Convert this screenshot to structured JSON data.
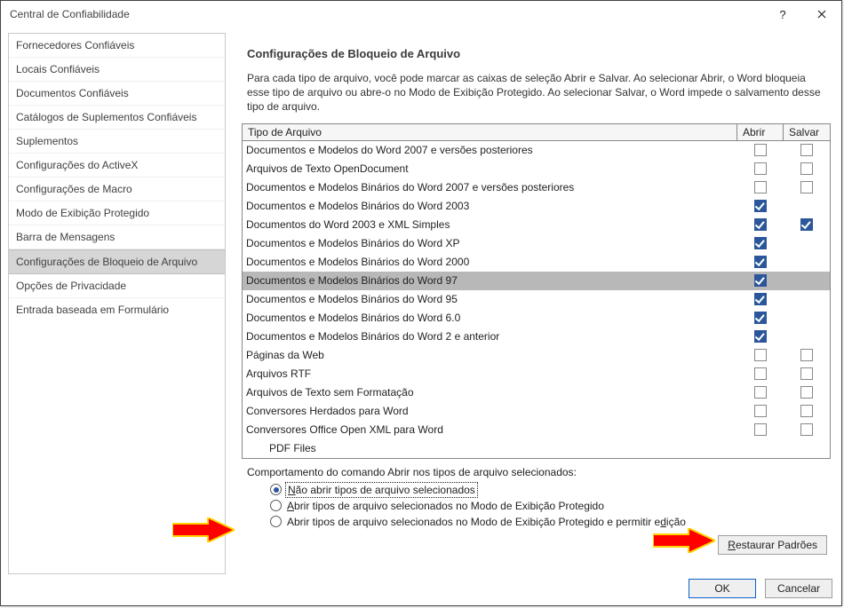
{
  "window": {
    "title": "Central de Confiabilidade"
  },
  "sidebar": {
    "items": [
      {
        "label": "Fornecedores Confiáveis"
      },
      {
        "label": "Locais Confiáveis"
      },
      {
        "label": "Documentos Confiáveis"
      },
      {
        "label": "Catálogos de Suplementos Confiáveis"
      },
      {
        "label": "Suplementos"
      },
      {
        "label": "Configurações do ActiveX"
      },
      {
        "label": "Configurações de Macro"
      },
      {
        "label": "Modo de Exibição Protegido"
      },
      {
        "label": "Barra de Mensagens"
      },
      {
        "label": "Configurações de Bloqueio de Arquivo"
      },
      {
        "label": "Opções de Privacidade"
      },
      {
        "label": "Entrada baseada em Formulário"
      }
    ],
    "selected_index": 9
  },
  "main": {
    "section_title": "Configurações de Bloqueio de Arquivo",
    "description": "Para cada tipo de arquivo, você pode marcar as caixas de seleção Abrir e Salvar. Ao selecionar Abrir, o Word bloqueia esse tipo de arquivo ou abre-o no Modo de Exibição Protegido. Ao selecionar Salvar, o Word impede o salvamento desse tipo de arquivo.",
    "columns": {
      "file_type": "Tipo de Arquivo",
      "open": "Abrir",
      "save": "Salvar"
    },
    "rows": [
      {
        "name": "Documentos e Modelos do Word 2007 e versões posteriores",
        "open": false,
        "save": false
      },
      {
        "name": "Arquivos de Texto OpenDocument",
        "open": false,
        "save": false
      },
      {
        "name": "Documentos e Modelos Binários do Word 2007 e versões posteriores",
        "open": false,
        "save": false
      },
      {
        "name": "Documentos e Modelos Binários do Word 2003",
        "open": true,
        "save": null
      },
      {
        "name": "Documentos do Word 2003 e XML Simples",
        "open": true,
        "save": true
      },
      {
        "name": "Documentos e Modelos Binários do Word XP",
        "open": true,
        "save": null
      },
      {
        "name": "Documentos e Modelos Binários do Word 2000",
        "open": true,
        "save": null
      },
      {
        "name": "Documentos e Modelos Binários do Word 97",
        "open": true,
        "save": null
      },
      {
        "name": "Documentos e Modelos Binários do Word 95",
        "open": true,
        "save": null
      },
      {
        "name": "Documentos e Modelos Binários do Word 6.0",
        "open": true,
        "save": null
      },
      {
        "name": "Documentos e Modelos Binários do Word 2 e anterior",
        "open": true,
        "save": null
      },
      {
        "name": "Páginas da Web",
        "open": false,
        "save": false
      },
      {
        "name": "Arquivos RTF",
        "open": false,
        "save": false
      },
      {
        "name": "Arquivos de Texto sem Formatação",
        "open": false,
        "save": false
      },
      {
        "name": "Conversores Herdados para Word",
        "open": false,
        "save": false
      },
      {
        "name": "Conversores Office Open XML para Word",
        "open": false,
        "save": false
      },
      {
        "name": "PDF Files",
        "open": null,
        "save": null,
        "indent": true
      }
    ],
    "selected_row_index": 7,
    "behavior_label": "Comportamento do comando Abrir nos tipos de arquivo selecionados:",
    "radios": [
      {
        "pre": "",
        "ul": "N",
        "post": "ão abrir tipos de arquivo selecionados"
      },
      {
        "pre": "",
        "ul": "A",
        "post": "brir tipos de arquivo selecionados no Modo de Exibição Protegido"
      },
      {
        "pre": "Abrir tipos de arquivo selecionados no Modo de Exibição Protegido e permitir e",
        "ul": "d",
        "post": "ição"
      }
    ],
    "selected_radio_index": 0,
    "restore_button": {
      "pre": "",
      "ul": "R",
      "post": "estaurar Padrões"
    }
  },
  "footer": {
    "ok": "OK",
    "cancel": "Cancelar"
  }
}
